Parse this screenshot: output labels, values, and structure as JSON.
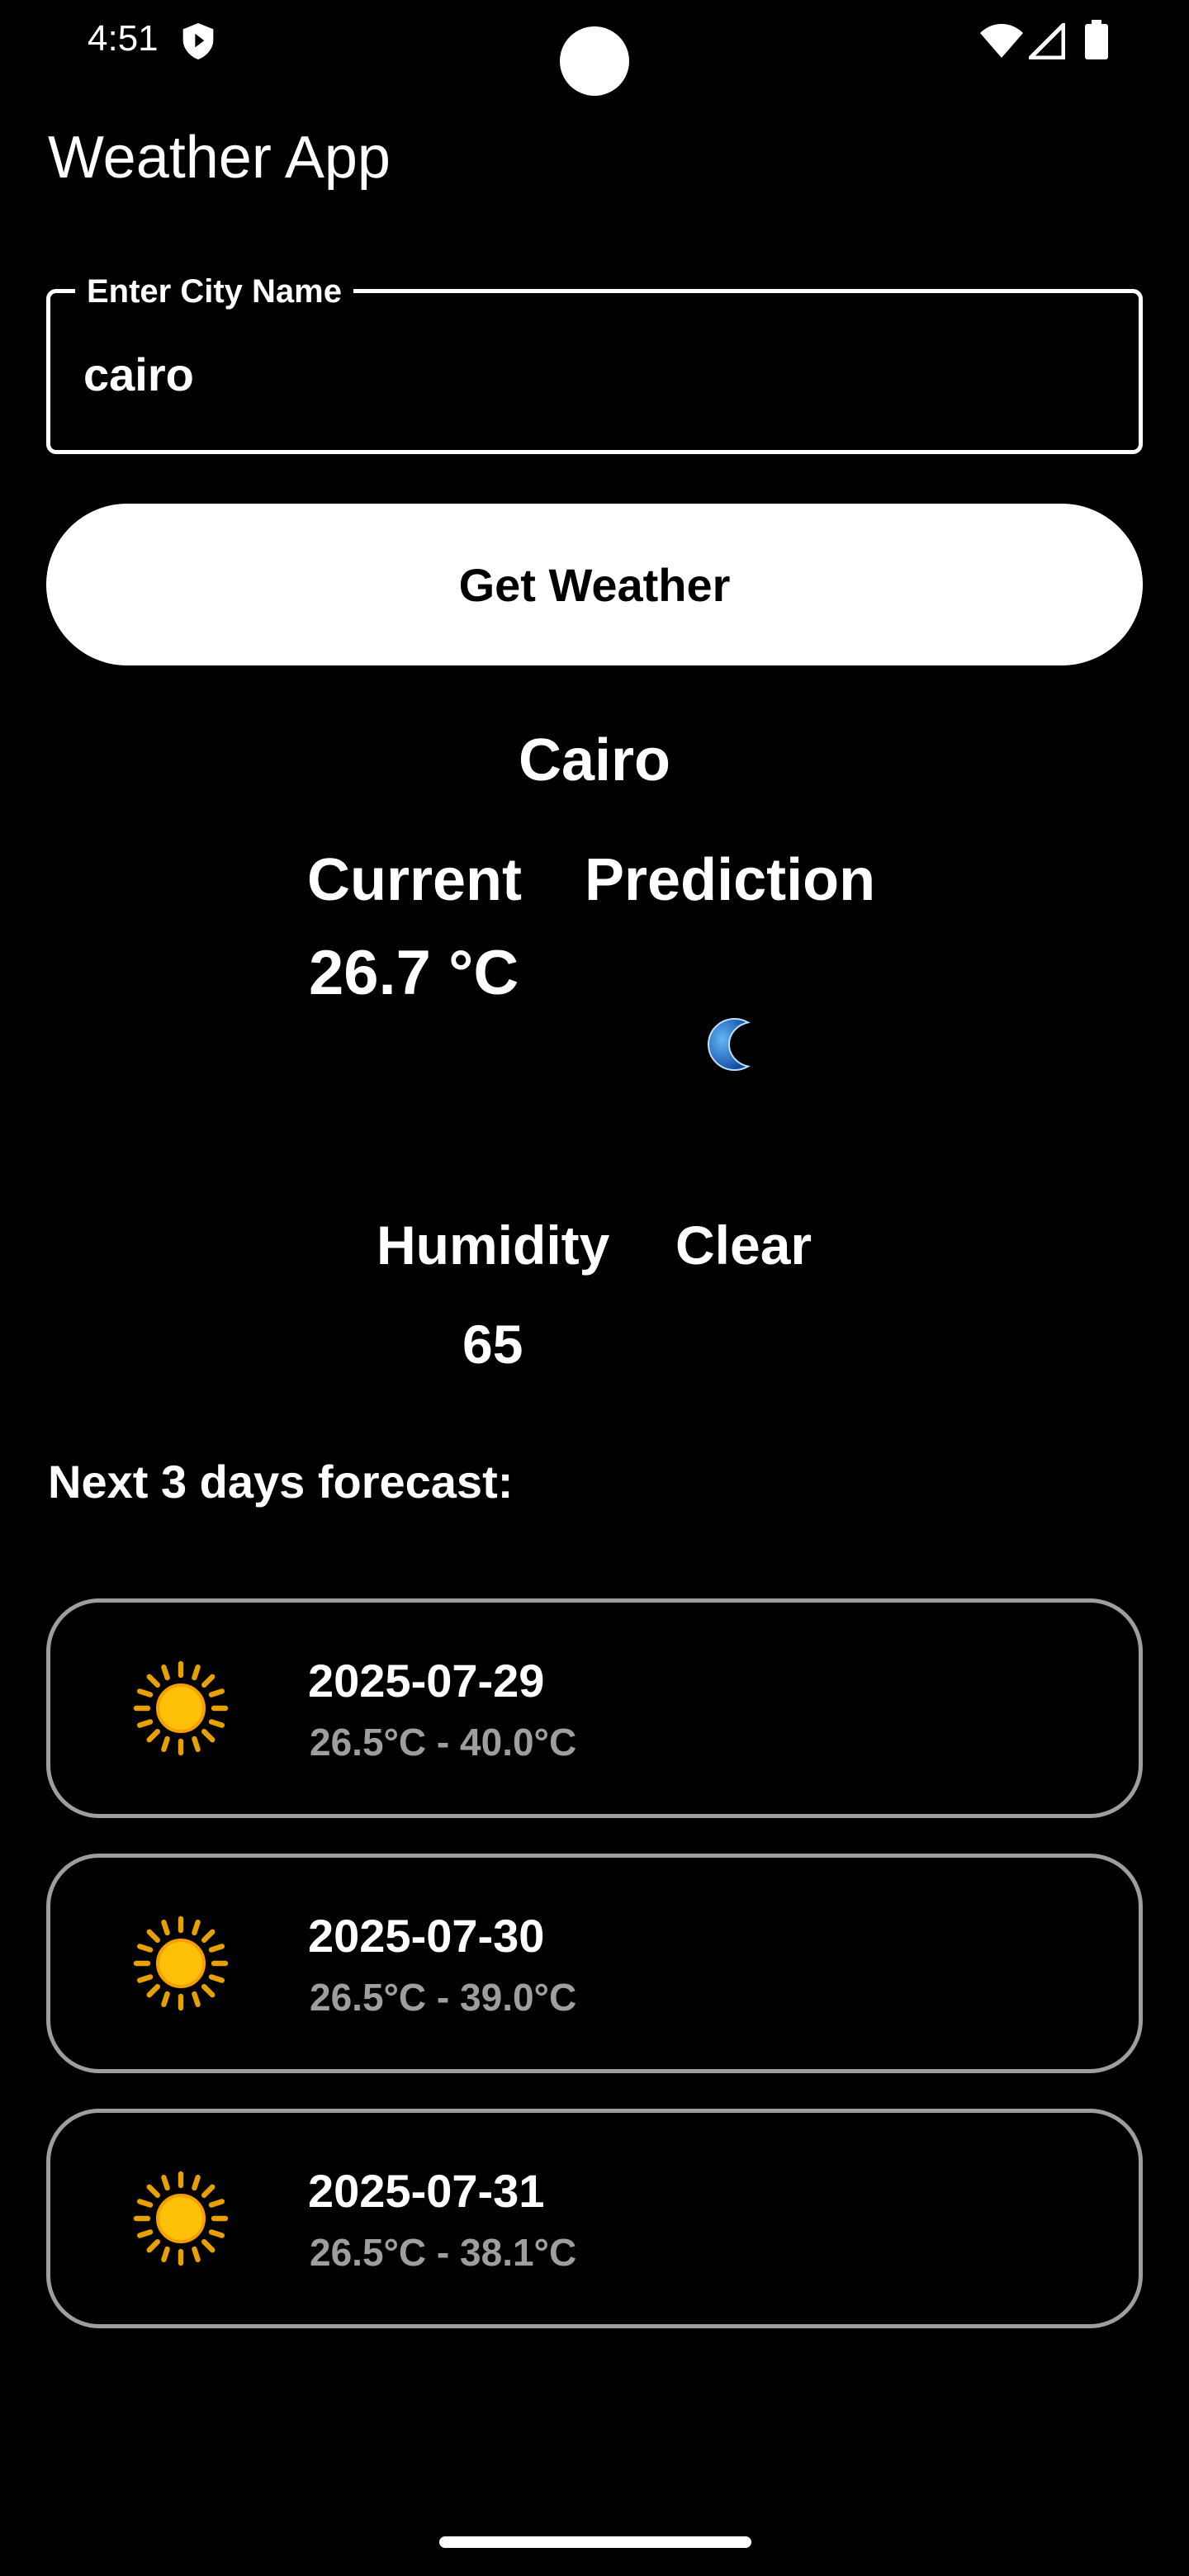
{
  "status_bar": {
    "time": "4:51"
  },
  "app": {
    "title": "Weather App"
  },
  "search": {
    "label": "Enter City Name",
    "value": "cairo",
    "button_label": "Get Weather"
  },
  "current": {
    "city": "Cairo",
    "current_label": "Current",
    "prediction_label": "Prediction",
    "temperature": "26.7 °C",
    "prediction_icon": "moon-icon",
    "humidity_label": "Humidity",
    "humidity_value": "65",
    "condition": "Clear"
  },
  "forecast": {
    "heading": "Next 3 days forecast:",
    "days": [
      {
        "date": "2025-07-29",
        "range": "26.5°C - 40.0°C",
        "icon": "sun-icon"
      },
      {
        "date": "2025-07-30",
        "range": "26.5°C - 39.0°C",
        "icon": "sun-icon"
      },
      {
        "date": "2025-07-31",
        "range": "26.5°C - 38.1°C",
        "icon": "sun-icon"
      }
    ]
  },
  "colors": {
    "background": "#000000",
    "foreground": "#ffffff",
    "card_border": "#9e9e9e",
    "secondary_text": "#9e9e9e",
    "sun": "#ffc107",
    "moon": "#1e88e5"
  }
}
